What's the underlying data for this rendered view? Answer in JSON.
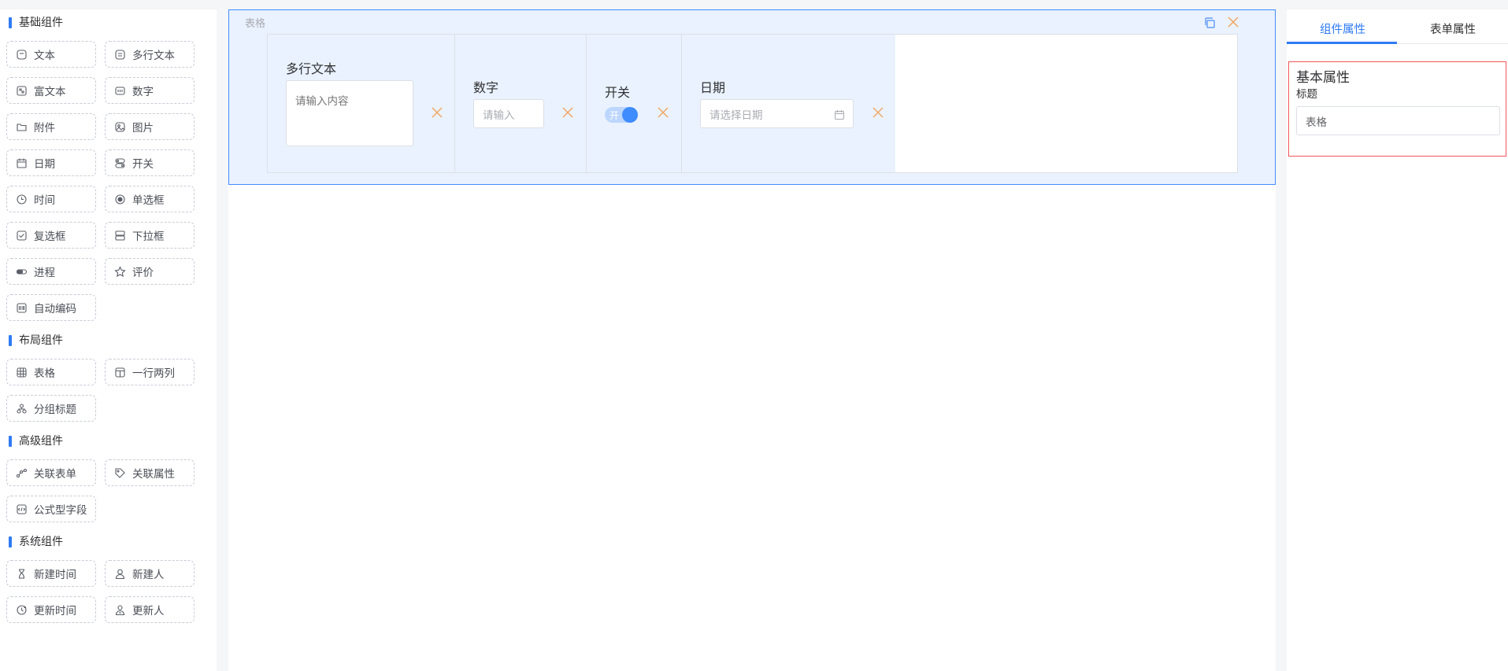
{
  "palette": {
    "groups": [
      {
        "title": "基础组件",
        "items": [
          {
            "label": "文本",
            "icon": "text-icon"
          },
          {
            "label": "多行文本",
            "icon": "multiline-text-icon"
          },
          {
            "label": "富文本",
            "icon": "rich-text-icon"
          },
          {
            "label": "数字",
            "icon": "number-icon"
          },
          {
            "label": "附件",
            "icon": "folder-icon"
          },
          {
            "label": "图片",
            "icon": "image-icon"
          },
          {
            "label": "日期",
            "icon": "calendar-icon"
          },
          {
            "label": "开关",
            "icon": "switch-icon"
          },
          {
            "label": "时间",
            "icon": "clock-icon"
          },
          {
            "label": "单选框",
            "icon": "radio-icon"
          },
          {
            "label": "复选框",
            "icon": "checkbox-icon"
          },
          {
            "label": "下拉框",
            "icon": "select-icon"
          },
          {
            "label": "进程",
            "icon": "progress-icon"
          },
          {
            "label": "评价",
            "icon": "star-icon"
          },
          {
            "label": "自动编码",
            "icon": "auto-code-icon"
          }
        ]
      },
      {
        "title": "布局组件",
        "items": [
          {
            "label": "表格",
            "icon": "table-icon"
          },
          {
            "label": "一行两列",
            "icon": "two-column-icon"
          },
          {
            "label": "分组标题",
            "icon": "group-title-icon"
          }
        ]
      },
      {
        "title": "高级组件",
        "items": [
          {
            "label": "关联表单",
            "icon": "link-form-icon"
          },
          {
            "label": "关联属性",
            "icon": "tag-icon"
          },
          {
            "label": "公式型字段",
            "icon": "formula-icon"
          }
        ]
      },
      {
        "title": "系统组件",
        "items": [
          {
            "label": "新建时间",
            "icon": "hourglass-icon"
          },
          {
            "label": "新建人",
            "icon": "user-icon"
          },
          {
            "label": "更新时间",
            "icon": "update-time-icon"
          },
          {
            "label": "更新人",
            "icon": "update-user-icon"
          }
        ]
      }
    ]
  },
  "canvas": {
    "table": {
      "caption": "表格",
      "cells": {
        "multiline": {
          "label": "多行文本",
          "placeholder": "请输入内容"
        },
        "number": {
          "label": "数字",
          "placeholder": "请输入"
        },
        "switch": {
          "label": "开关",
          "on_text": "开",
          "value": true
        },
        "date": {
          "label": "日期",
          "placeholder": "请选择日期"
        }
      }
    }
  },
  "props": {
    "tabs": [
      "组件属性",
      "表单属性"
    ],
    "active_tab": 0,
    "section_title": "基本属性",
    "title_label": "标题",
    "title_value": "表格"
  },
  "colors": {
    "accent": "#2f7bf5",
    "delete": "#f0a55e",
    "highlight_border": "#f1565c"
  }
}
